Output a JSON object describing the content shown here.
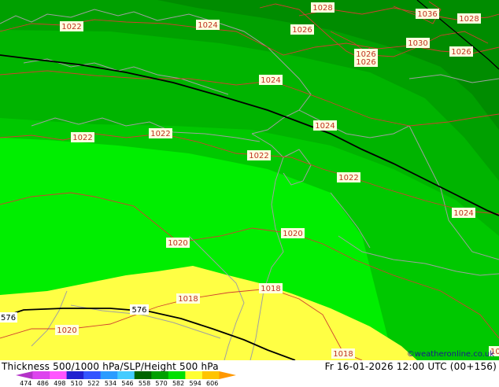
{
  "title_left": "Thickness 500/1000 hPa/SLP/Height 500 hPa",
  "title_right": "Fr 16-01-2026 12:00 UTC (00+156)",
  "credit": "©weatheronline.co.uk",
  "legend": {
    "ticks": [
      "474",
      "486",
      "498",
      "510",
      "522",
      "534",
      "546",
      "558",
      "570",
      "582",
      "594",
      "606"
    ],
    "colors": [
      "#b432c8",
      "#dd44ee",
      "#ff55ff",
      "#2020d0",
      "#3355ff",
      "#2a9cff",
      "#44ccff",
      "#006400",
      "#00a000",
      "#00e000",
      "#ffff33",
      "#ffc400",
      "#ff9800"
    ]
  },
  "pressure_labels": [
    "1022",
    "1024",
    "1026",
    "1028",
    "1036",
    "1028",
    "1030",
    "1026",
    "1026",
    "1026",
    "1024",
    "1024",
    "1022",
    "1022",
    "1022",
    "1022",
    "1024",
    "1020",
    "1020",
    "1018",
    "1018",
    "1020",
    "1018",
    "1024"
  ],
  "height_labels": [
    "576",
    "576"
  ]
}
